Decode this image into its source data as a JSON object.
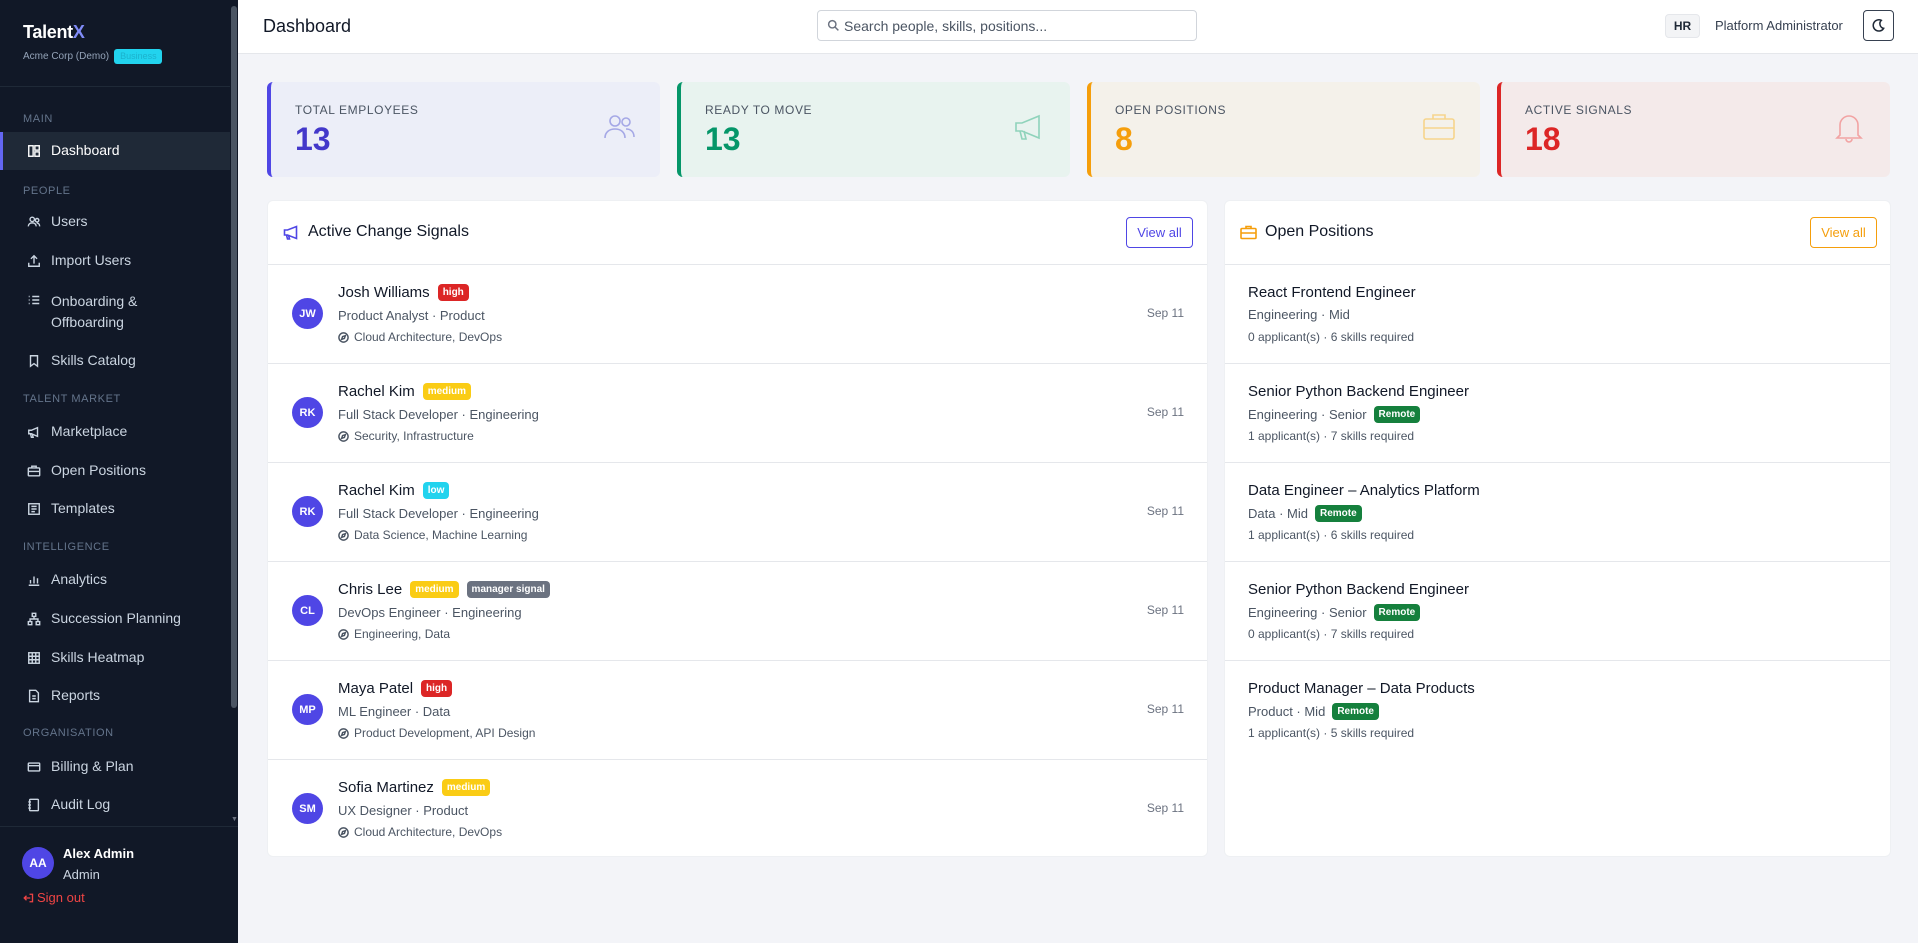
{
  "sidebar": {
    "brand": {
      "name": "Talent",
      "name_accent": "X",
      "org": "Acme Corp (Demo)",
      "badge": "Business"
    },
    "sections": {
      "main": "MAIN",
      "people": "PEOPLE",
      "talent_market": "TALENT MARKET",
      "intelligence": "INTELLIGENCE",
      "organisation": "ORGANISATION"
    },
    "items": {
      "dashboard": "Dashboard",
      "users": "Users",
      "import_users": "Import Users",
      "onboarding": "Onboarding &",
      "onboarding_2": "Offboarding",
      "skills_catalog": "Skills Catalog",
      "marketplace": "Marketplace",
      "open_positions": "Open Positions",
      "templates": "Templates",
      "analytics": "Analytics",
      "succession": "Succession Planning",
      "skills_heatmap": "Skills Heatmap",
      "reports": "Reports",
      "billing": "Billing & Plan",
      "audit_log": "Audit Log"
    },
    "user": {
      "initials": "AA",
      "name": "Alex Admin",
      "role": "Admin",
      "signout": "Sign out"
    }
  },
  "header": {
    "title": "Dashboard",
    "search_placeholder": "Search people, skills, positions...",
    "role_badge": "HR",
    "admin_name": "Platform Administrator"
  },
  "stats": [
    {
      "label": "TOTAL EMPLOYEES",
      "value": "13",
      "icon": "users-icon",
      "color": "#4f46e5"
    },
    {
      "label": "READY TO MOVE",
      "value": "13",
      "icon": "megaphone-icon",
      "color": "#059669"
    },
    {
      "label": "OPEN POSITIONS",
      "value": "8",
      "icon": "briefcase-icon",
      "color": "#f59e0b"
    },
    {
      "label": "ACTIVE SIGNALS",
      "value": "18",
      "icon": "bell-icon",
      "color": "#dc2626"
    }
  ],
  "signals_panel": {
    "title": "Active Change Signals",
    "view_all": "View all",
    "rows": [
      {
        "initials": "JW",
        "name": "Josh Williams",
        "priority": "high",
        "role": "Product Analyst · Product",
        "skills": "Cloud Architecture, DevOps",
        "date": "Sep 11"
      },
      {
        "initials": "RK",
        "name": "Rachel Kim",
        "priority": "medium",
        "role": "Full Stack Developer · Engineering",
        "skills": "Security, Infrastructure",
        "date": "Sep 11"
      },
      {
        "initials": "RK",
        "name": "Rachel Kim",
        "priority": "low",
        "role": "Full Stack Developer · Engineering",
        "skills": "Data Science, Machine Learning",
        "date": "Sep 11"
      },
      {
        "initials": "CL",
        "name": "Chris Lee",
        "priority": "medium",
        "extra_badge": "manager signal",
        "role": "DevOps Engineer · Engineering",
        "skills": "Engineering, Data",
        "date": "Sep 11"
      },
      {
        "initials": "MP",
        "name": "Maya Patel",
        "priority": "high",
        "role": "ML Engineer · Data",
        "skills": "Product Development, API Design",
        "date": "Sep 11"
      },
      {
        "initials": "SM",
        "name": "Sofia Martinez",
        "priority": "medium",
        "role": "UX Designer · Product",
        "skills": "Cloud Architecture, DevOps",
        "date": "Sep 11"
      }
    ]
  },
  "positions_panel": {
    "title": "Open Positions",
    "view_all": "View all",
    "rows": [
      {
        "title": "React Frontend Engineer",
        "meta": "Engineering · Mid",
        "remote": "",
        "stats": "0 applicant(s) · 6 skills required"
      },
      {
        "title": "Senior Python Backend Engineer",
        "meta": "Engineering · Senior",
        "remote": "Remote",
        "stats": "1 applicant(s) · 7 skills required"
      },
      {
        "title": "Data Engineer – Analytics Platform",
        "meta": "Data · Mid",
        "remote": "Remote",
        "stats": "1 applicant(s) · 6 skills required"
      },
      {
        "title": "Senior Python Backend Engineer",
        "meta": "Engineering · Senior",
        "remote": "Remote",
        "stats": "0 applicant(s) · 7 skills required"
      },
      {
        "title": "Product Manager – Data Products",
        "meta": "Product · Mid",
        "remote": "Remote",
        "stats": "1 applicant(s) · 5 skills required"
      }
    ]
  }
}
